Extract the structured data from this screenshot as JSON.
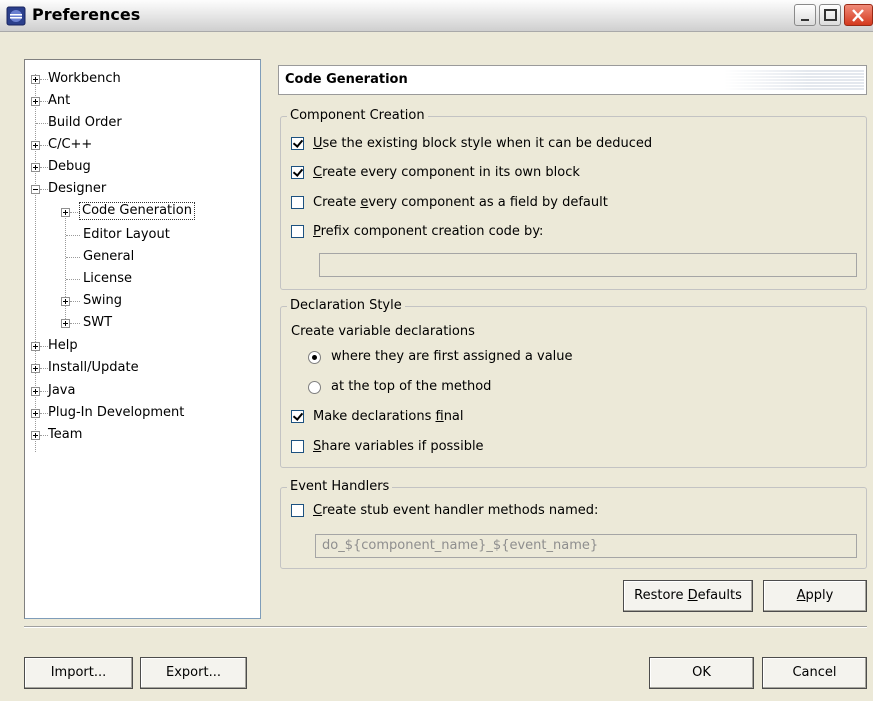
{
  "window": {
    "title": "Preferences"
  },
  "tree": {
    "items": [
      {
        "label": "Workbench"
      },
      {
        "label": "Ant"
      },
      {
        "label": "Build Order"
      },
      {
        "label": "C/C++"
      },
      {
        "label": "Debug"
      },
      {
        "label": "Designer"
      },
      {
        "label": "Code Generation"
      },
      {
        "label": "Editor Layout"
      },
      {
        "label": "General"
      },
      {
        "label": "License"
      },
      {
        "label": "Swing"
      },
      {
        "label": "SWT"
      },
      {
        "label": "Help"
      },
      {
        "label": "Install/Update"
      },
      {
        "label": "Java"
      },
      {
        "label": "Plug-In Development"
      },
      {
        "label": "Team"
      }
    ]
  },
  "page": {
    "title": "Code Generation"
  },
  "component_creation": {
    "legend": "Component Creation",
    "use_existing": {
      "mnemonic": "U",
      "rest": "se the existing block style when it can be deduced",
      "checked": true
    },
    "own_block": {
      "mnemonic": "C",
      "rest": "reate every component in its own block",
      "checked": true
    },
    "as_field": {
      "pre": "Create ",
      "mnemonic": "e",
      "rest": "very component as a field by default",
      "checked": false
    },
    "prefix": {
      "mnemonic": "P",
      "rest": "refix component creation code by:",
      "checked": false
    },
    "prefix_value": ""
  },
  "declaration_style": {
    "legend": "Declaration Style",
    "subtitle": "Create variable declarations",
    "where_assigned": {
      "label": "where they are first assigned a value",
      "selected": true
    },
    "top_of_method": {
      "label": "at the top of the method",
      "selected": false
    },
    "final": {
      "pre": "Make declarations ",
      "mnemonic": "f",
      "rest": "inal",
      "checked": true
    },
    "share": {
      "mnemonic": "S",
      "rest": "hare variables if possible",
      "checked": false
    }
  },
  "event_handlers": {
    "legend": "Event Handlers",
    "stub": {
      "mnemonic": "C",
      "rest": "reate stub event handler methods named:",
      "checked": false
    },
    "stub_value": "do_${component_name}_${event_name}"
  },
  "buttons": {
    "restore_pre": "Restore ",
    "restore_mnemonic": "D",
    "restore_rest": "efaults",
    "apply_mnemonic": "A",
    "apply_rest": "pply",
    "import": "Import...",
    "export": "Export...",
    "ok": "OK",
    "cancel": "Cancel"
  },
  "colors": {
    "window_bg": "#ece9d8",
    "tree_bg": "#ffffff",
    "close_button": "#d4391e"
  }
}
